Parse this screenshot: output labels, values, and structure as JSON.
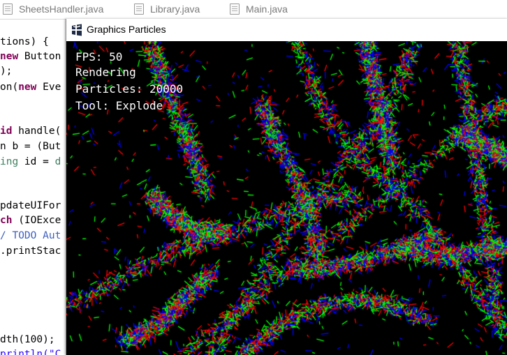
{
  "ide": {
    "tabs": [
      {
        "label": "SheetsHandler.java"
      },
      {
        "label": "Library.java"
      },
      {
        "label": "Main.java"
      }
    ],
    "code_lines": [
      "tions) {",
      "new Button",
      ");",
      "on(new Eve",
      "",
      "",
      "id handle(",
      "n b = (But",
      "ing id = d",
      "",
      "",
      "pdateUIFor",
      "ch (IOExce",
      "/ TODO Aut",
      ".printStac",
      "",
      "",
      "",
      "",
      "",
      "dth(100);",
      "println(\"C"
    ]
  },
  "window": {
    "title": "Graphics Particles"
  },
  "hud": {
    "fps": "FPS: 50",
    "status": "Rendering",
    "particles": "Particles: 20000",
    "tool": "Tool: Explode"
  },
  "colors": {
    "particle_colors": [
      "#00ff00",
      "#ff0000",
      "#0000ff"
    ],
    "canvas_background": "#000000"
  }
}
